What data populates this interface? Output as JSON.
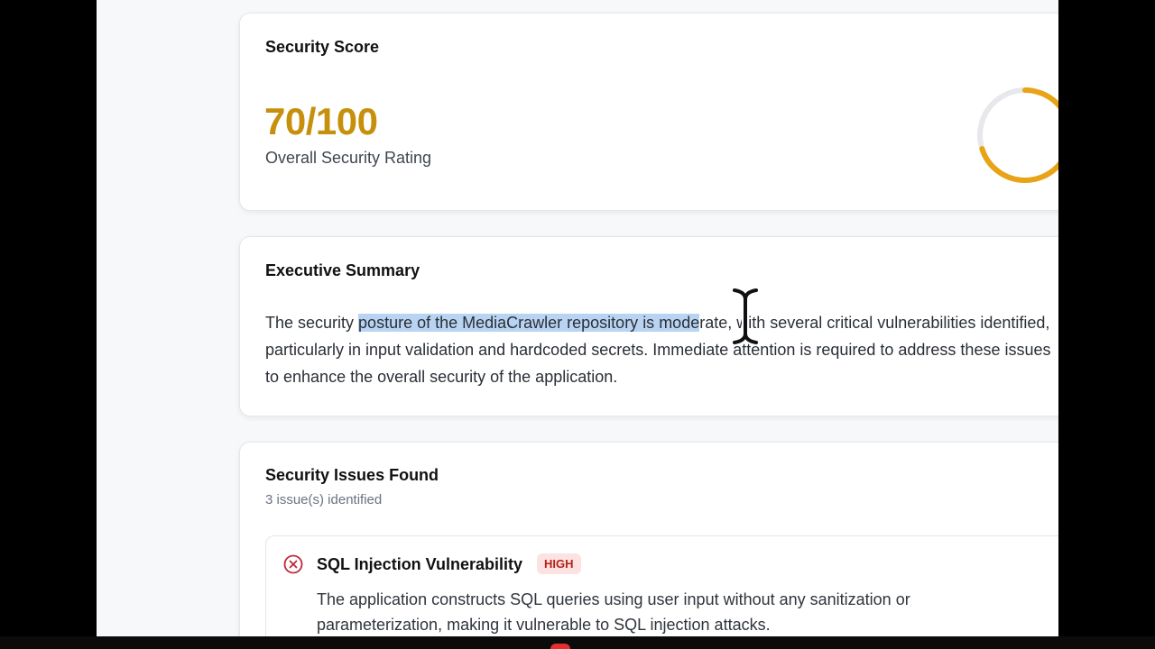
{
  "score_card": {
    "title": "Security Score",
    "score": "70/100",
    "label": "Overall Security Rating",
    "score_fraction": 0.7,
    "accent_color": "#c68f0c",
    "gauge_color": "#e8a317"
  },
  "summary": {
    "title": "Executive Summary",
    "text_before": "The security ",
    "text_highlight": "posture of the MediaCrawler repository is mode",
    "text_after": "rate, with several critical vulnerabilities identified, particularly in input validation and hardcoded secrets. Immediate attention is required to address these issues to enhance the overall security of the application.",
    "highlight_color": "#b8d4f2"
  },
  "issues": {
    "title": "Security Issues Found",
    "count_text": "3 issue(s) identified",
    "items": [
      {
        "icon": "x-circle-icon",
        "title": "SQL Injection Vulnerability",
        "severity": "HIGH",
        "description": "The application constructs SQL queries using user input without any sanitization or parameterization, making it vulnerable to SQL injection attacks."
      }
    ]
  },
  "cursor": {
    "icon": "text-cursor-icon"
  }
}
